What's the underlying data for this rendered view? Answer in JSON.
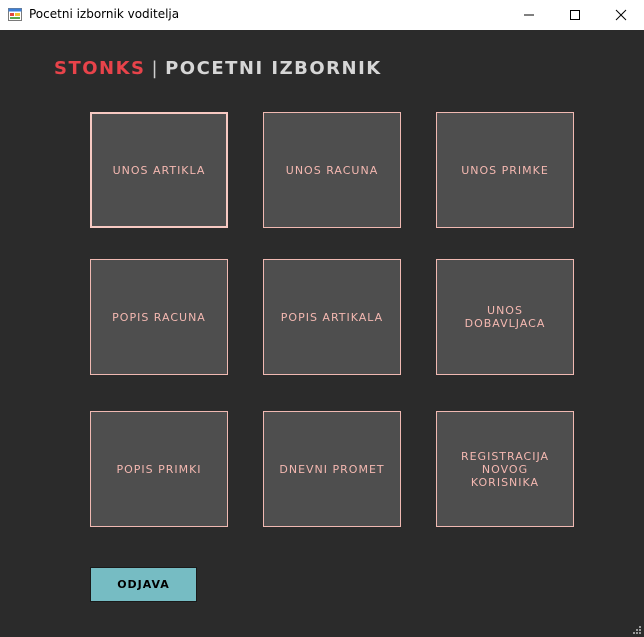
{
  "window": {
    "title": "Pocetni izbornik voditelja",
    "controls": [
      "minimize-icon",
      "maximize-icon",
      "close-icon"
    ]
  },
  "header": {
    "brand": "STONKS",
    "separator": "|",
    "title": "POCETNI IZBORNIK"
  },
  "menu": {
    "tiles": [
      {
        "label": "UNOS ARTIKLA"
      },
      {
        "label": "UNOS RACUNA"
      },
      {
        "label": "UNOS PRIMKE"
      },
      {
        "label": "POPIS RACUNA"
      },
      {
        "label": "POPIS ARTIKALA"
      },
      {
        "label": "UNOS\nDOBAVLJACA"
      },
      {
        "label": "POPIS PRIMKI"
      },
      {
        "label": "DNEVNI PROMET"
      },
      {
        "label": "REGISTRACIJA\nNOVOG\nKORISNIKA"
      }
    ]
  },
  "footer": {
    "logout_label": "ODJAVA"
  },
  "colors": {
    "background": "#2b2b2b",
    "tile_bg": "#4e4e4e",
    "tile_border": "#f0b9b2",
    "tile_text": "#f4b8b1",
    "brand_red": "#e8434a",
    "logout_bg": "#76bcc3"
  }
}
